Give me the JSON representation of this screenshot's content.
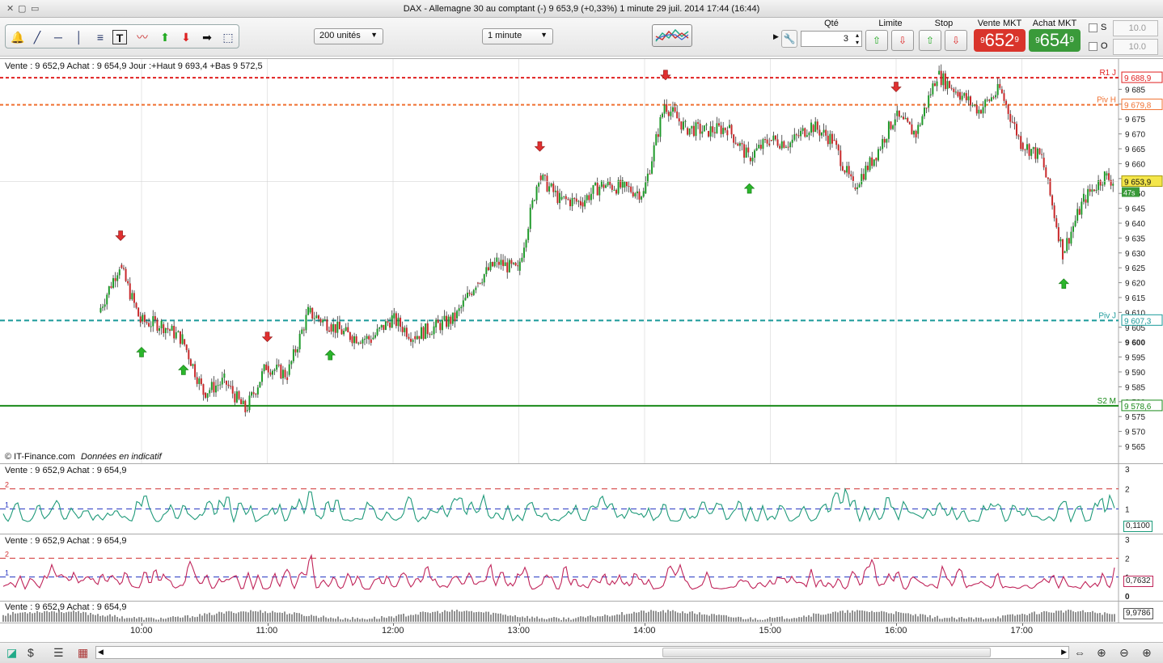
{
  "window": {
    "title": "DAX - Allemagne 30 au comptant (-)     9 653,9 (+0,33%)     1 minute  29 juil. 2014 17:44 (16:44)"
  },
  "toolbar": {
    "tools": [
      "bell-icon",
      "line-tool-icon",
      "horizontal-line-icon",
      "vertical-line-icon",
      "fibonacci-icon",
      "text-tool-icon",
      "indicator-icon",
      "arrow-up-icon",
      "arrow-down-icon",
      "arrow-right-icon",
      "zoom-rect-icon"
    ],
    "units_select": "200 unités",
    "interval_select": "1 minute"
  },
  "order": {
    "qty_label": "Qté",
    "qty_value": "3",
    "limit_label": "Limite",
    "stop_label": "Stop",
    "sell_label": "Vente MKT",
    "buy_label": "Achat MKT",
    "sell_prefix": "9",
    "sell_main": "652",
    "sell_suffix": "9",
    "buy_prefix": "9",
    "buy_main": "654",
    "buy_suffix": "9",
    "sell_color": "#d9342b",
    "buy_color": "#3a9a3a",
    "s_label": "S",
    "o_label": "O",
    "s_value": "10.0",
    "o_value": "10.0"
  },
  "main_panel": {
    "info": "Vente : 9 652,9 Achat : 9 654,9  Jour :+Haut 9 693,4 +Bas 9 572,5",
    "copyright": "© IT-Finance.com",
    "disclaimer": "Données en indicatif",
    "countdown": "47s",
    "price_tag": "9 653,9",
    "levels": [
      {
        "label": "R1 J",
        "value": "9 688,9",
        "color": "#e02020"
      },
      {
        "label": "Piv H",
        "value": "9 679,8",
        "color": "#f07030"
      },
      {
        "label": "Piv J",
        "value": "9 607,3",
        "color": "#1a9a9a"
      },
      {
        "label": "S2 M",
        "value": "9 578,6",
        "color": "#1a8a1a"
      }
    ],
    "y_ticks": [
      "9 685",
      "9 680",
      "9 675",
      "9 670",
      "9 665",
      "9 660",
      "9 655",
      "9 650",
      "9 645",
      "9 640",
      "9 635",
      "9 630",
      "9 625",
      "9 620",
      "9 615",
      "9 610",
      "9 605",
      "9 600",
      "9 595",
      "9 590",
      "9 585",
      "9 580",
      "9 575",
      "9 570",
      "9 565"
    ]
  },
  "panel2": {
    "info": "Vente : 9 652,9 Achat : 9 654,9",
    "value": "0,1100",
    "ticks": [
      "3",
      "2",
      "1",
      "0"
    ]
  },
  "panel3": {
    "info": "Vente : 9 652,9 Achat : 9 654,9",
    "value": "0,7632",
    "ticks": [
      "3",
      "2",
      "1",
      "0"
    ]
  },
  "panel4": {
    "info": "Vente : 9 652,9 Achat : 9 654,9",
    "value": "9,9786"
  },
  "x_labels": [
    "10:00",
    "11:00",
    "12:00",
    "13:00",
    "14:00",
    "15:00",
    "16:00",
    "17:00"
  ],
  "chart_data": {
    "type": "candlestick",
    "title": "DAX - Allemagne 30 au comptant (-)",
    "x": [
      "09:40",
      "09:50",
      "10:00",
      "10:10",
      "10:20",
      "10:30",
      "10:40",
      "10:50",
      "11:00",
      "11:10",
      "11:20",
      "11:30",
      "11:40",
      "11:50",
      "12:00",
      "12:10",
      "12:20",
      "12:30",
      "12:40",
      "12:50",
      "13:00",
      "13:10",
      "13:20",
      "13:30",
      "13:40",
      "13:50",
      "14:00",
      "14:10",
      "14:20",
      "14:30",
      "14:40",
      "14:50",
      "15:00",
      "15:10",
      "15:20",
      "15:30",
      "15:40",
      "15:50",
      "16:00",
      "16:10",
      "16:20",
      "16:30",
      "16:40",
      "16:50",
      "17:00",
      "17:10",
      "17:20",
      "17:30",
      "17:40",
      "17:44"
    ],
    "close": [
      9610,
      9626,
      9607,
      9606,
      9601,
      9583,
      9587,
      9577,
      9592,
      9589,
      9610,
      9606,
      9602,
      9601,
      9608,
      9602,
      9605,
      9608,
      9620,
      9627,
      9624,
      9656,
      9648,
      9647,
      9653,
      9652,
      9650,
      9680,
      9672,
      9671,
      9672,
      9662,
      9668,
      9667,
      9673,
      9668,
      9652,
      9662,
      9676,
      9670,
      9690,
      9684,
      9678,
      9685,
      9667,
      9662,
      9630,
      9648,
      9656,
      9654
    ],
    "ylim": [
      9562,
      9693
    ],
    "signals_up": [
      "10:00",
      "10:20",
      "11:30",
      "14:50",
      "17:20"
    ],
    "signals_down": [
      "09:50",
      "11:00",
      "13:10",
      "14:10",
      "16:00"
    ]
  },
  "status": {
    "icons": [
      "chart-plus-icon",
      "indicator-icon",
      "list-icon",
      "grid-icon"
    ],
    "nav": [
      "scroll-left-icon",
      "scroll-right-icon",
      "autoscale-icon",
      "zoom-fit-icon",
      "zoom-out-icon",
      "zoom-in-icon"
    ]
  }
}
